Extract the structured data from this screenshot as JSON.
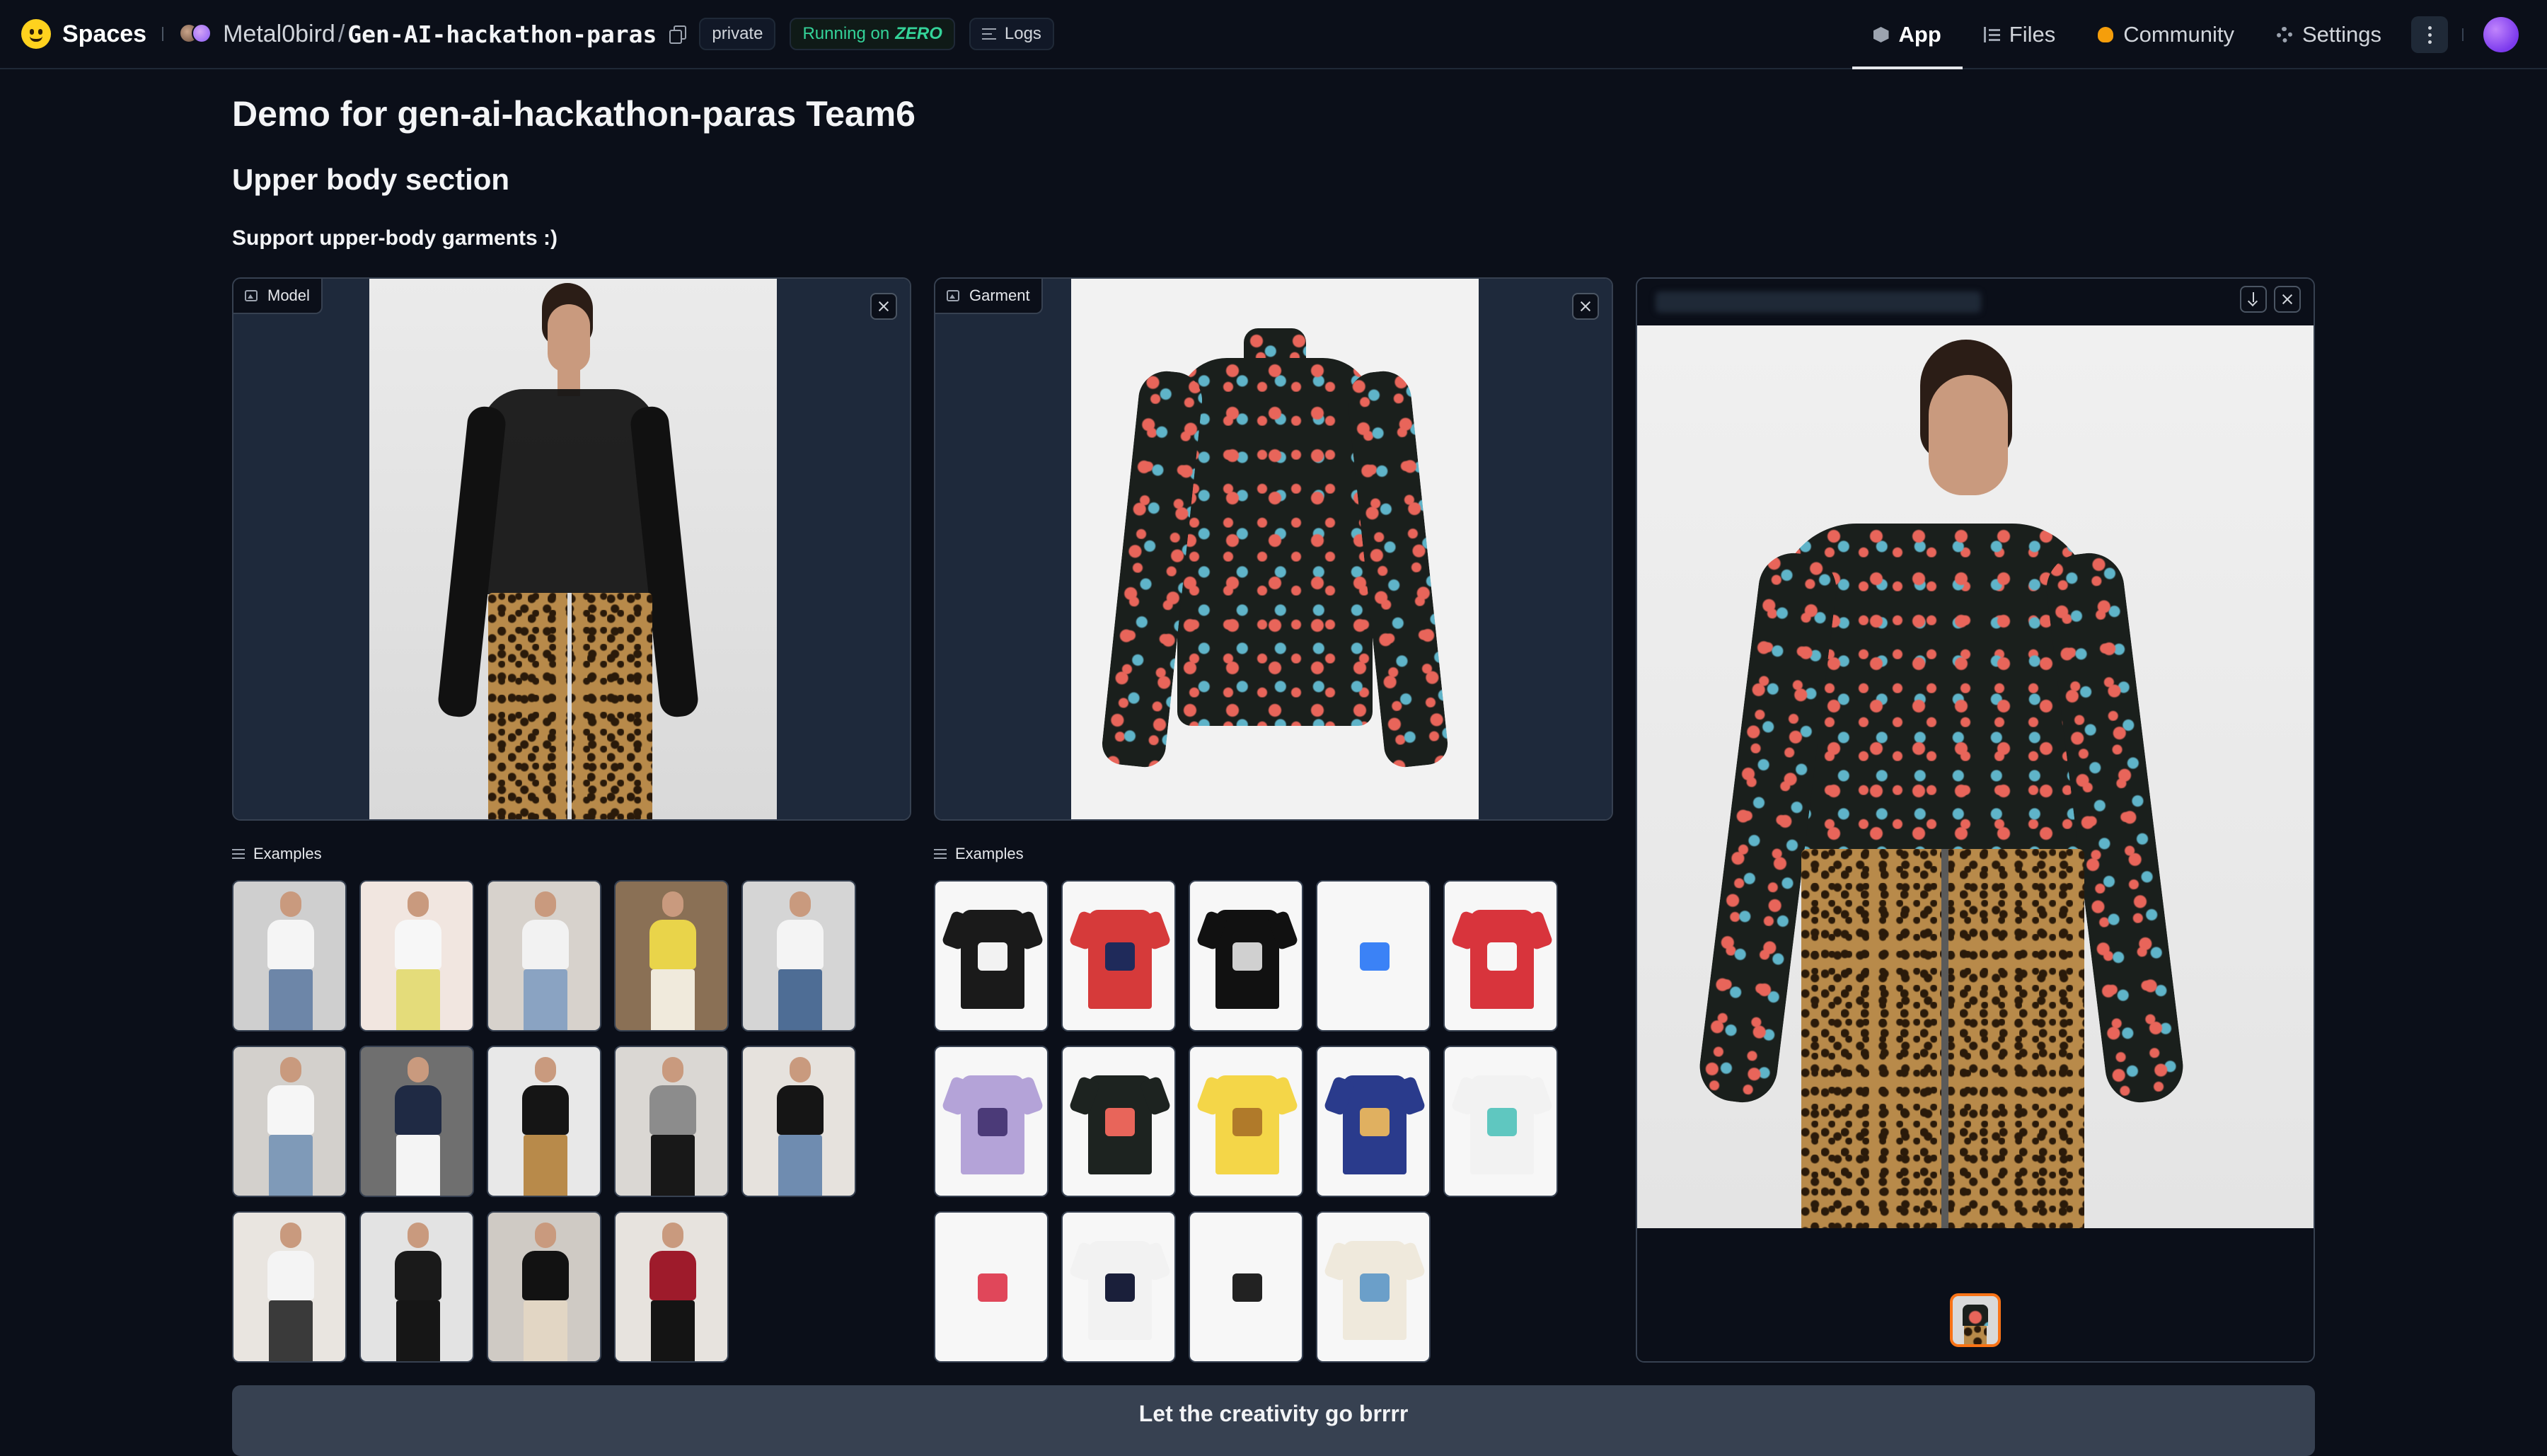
{
  "header": {
    "brand": "Spaces",
    "owner": "Metal0bird",
    "repo": "Gen-AI-hackathon-paras",
    "visibility": "private",
    "status_prefix": "Running on",
    "status_hardware": "ZERO",
    "logs_label": "Logs",
    "nav": [
      {
        "label": "App",
        "icon": "cube-icon",
        "active": true
      },
      {
        "label": "Files",
        "icon": "files-icon",
        "active": false
      },
      {
        "label": "Community",
        "icon": "community-icon",
        "active": false
      },
      {
        "label": "Settings",
        "icon": "gear-icon",
        "active": false
      }
    ]
  },
  "main": {
    "title": "Demo for gen-ai-hackathon-paras Team6",
    "section_title": "Upper body section",
    "section_subtitle": "Support upper-body garments :)",
    "model_label": "Model",
    "garment_label": "Garment",
    "examples_label": "Examples",
    "submit_label": "Let the creativity go brrrr"
  },
  "model_examples": [
    {
      "top": "#f5f5f5",
      "bottom": "#6d86a8",
      "bg": "#cfcfcf"
    },
    {
      "top": "#f7f7f7",
      "bottom": "#e4dc7a",
      "bg": "#f1e6e0"
    },
    {
      "top": "#f2f2f2",
      "bottom": "#8aa3c2",
      "bg": "#d7d2cc"
    },
    {
      "top": "#e9d44a",
      "bottom": "#f0eadc",
      "bg": "#8a7055"
    },
    {
      "top": "#f4f4f4",
      "bottom": "#4e6d95",
      "bg": "#d5d5d5"
    },
    {
      "top": "#f6f6f6",
      "bottom": "#7f9ab8",
      "bg": "#d3d0cc"
    },
    {
      "top": "#1f2a44",
      "bottom": "#f4f4f4",
      "bg": "#6f6f6f"
    },
    {
      "top": "#151515",
      "bottom": "#b88a4a",
      "bg": "#e8e8e8"
    },
    {
      "top": "#8c8c8c",
      "bottom": "#181818",
      "bg": "#dad7d3"
    },
    {
      "top": "#151515",
      "bottom": "#6f8cb0",
      "bg": "#e6e2dd"
    },
    {
      "top": "#f4f4f4",
      "bottom": "#3a3a3a",
      "bg": "#e9e5e0"
    },
    {
      "top": "#1a1a1a",
      "bottom": "#161616",
      "bg": "#e3e3e3"
    },
    {
      "top": "#121212",
      "bottom": "#e2d6c4",
      "bg": "#cfcac4"
    },
    {
      "top": "#9e1b2b",
      "bottom": "#141414",
      "bg": "#e7e3de"
    }
  ],
  "garment_examples": [
    {
      "color": "#1a1a1a",
      "accent": "#f2f2f2"
    },
    {
      "color": "#d63a3a",
      "accent": "#1f2a5a"
    },
    {
      "color": "#111111",
      "accent": "#d0d0d0"
    },
    {
      "color": "#f7f7f7",
      "accent": "#3b82f6"
    },
    {
      "color": "#d8343c",
      "accent": "#f7f7f7"
    },
    {
      "color": "#b4a3d8",
      "accent": "#4b3a78"
    },
    {
      "color": "#1d2320",
      "accent": "#e8655a"
    },
    {
      "color": "#f4d648",
      "accent": "#b07a2a"
    },
    {
      "color": "#2a3b8c",
      "accent": "#e0b060"
    },
    {
      "color": "#f2f2f2",
      "accent": "#5fc7c0"
    },
    {
      "color": "#f7f7f7",
      "accent": "#e0475a"
    },
    {
      "color": "#f2f2f2",
      "accent": "#1a1f3a"
    },
    {
      "color": "#f7f7f7",
      "accent": "#222222"
    },
    {
      "color": "#efe9dc",
      "accent": "#6b9fc9"
    }
  ]
}
